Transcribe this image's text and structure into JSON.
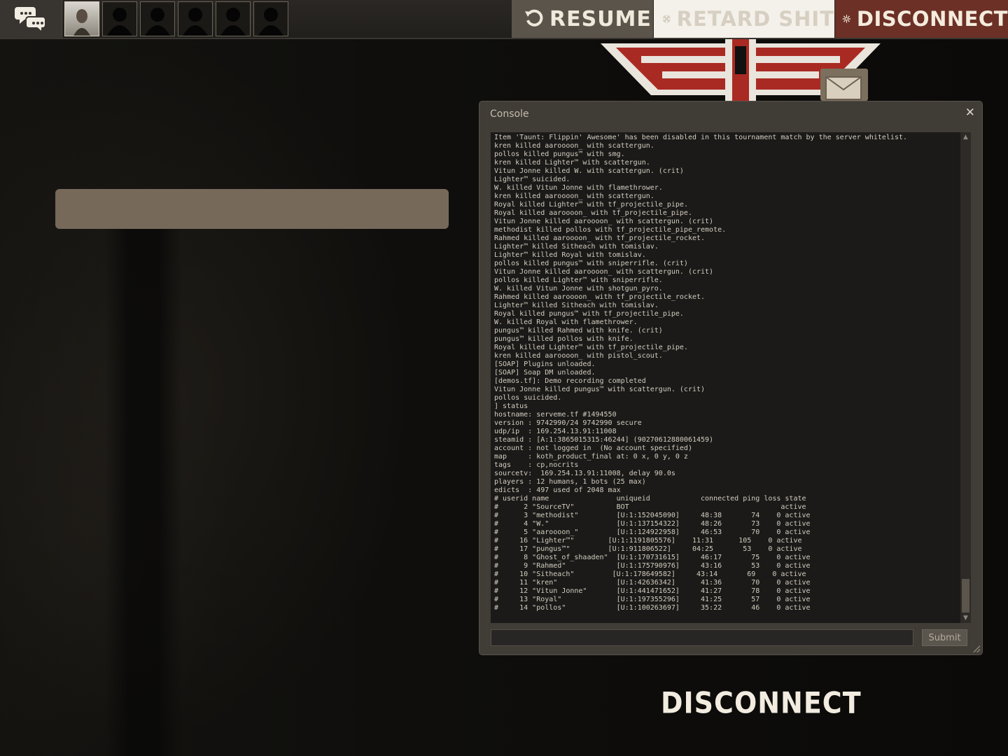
{
  "topbar": {
    "resume_label": "RESUME",
    "retard_label": "RETARD SHIT",
    "disconnect_label": "DISCONNECT"
  },
  "console": {
    "title": "Console",
    "close_glyph": "✕",
    "submit_label": "Submit",
    "input_value": "",
    "lines": [
      "Item 'Taunt: Flippin' Awesome' has been disabled in this tournament match by the server whitelist.",
      "kren killed aaroooon_ with scattergun.",
      "pollos killed pungus™ with smg.",
      "kren killed Lighter™ with scattergun.",
      "Vitun Jonne killed W. with scattergun. (crit)",
      "Lighter™ suicided.",
      "W. killed Vitun Jonne with flamethrower.",
      "kren killed aaroooon_ with scattergun.",
      "Royal killed Lighter™ with tf_projectile_pipe.",
      "Royal killed aaroooon_ with tf_projectile_pipe.",
      "Vitun Jonne killed aaroooon_ with scattergun. (crit)",
      "methodist killed pollos with tf_projectile_pipe_remote.",
      "Rahmed killed aaroooon_ with tf_projectile_rocket.",
      "Lighter™ killed Sitheach with tomislav.",
      "Lighter™ killed Royal with tomislav.",
      "pollos killed pungus™ with sniperrifle. (crit)",
      "Vitun Jonne killed aaroooon_ with scattergun. (crit)",
      "pollos killed Lighter™ with sniperrifle.",
      "W. killed Vitun Jonne with shotgun_pyro.",
      "Rahmed killed aaroooon_ with tf_projectile_rocket.",
      "Lighter™ killed Sitheach with tomislav.",
      "Royal killed pungus™ with tf_projectile_pipe.",
      "W. killed Royal with flamethrower.",
      "pungus™ killed Rahmed with knife. (crit)",
      "pungus™ killed pollos with knife.",
      "Royal killed Lighter™ with tf_projectile_pipe.",
      "kren killed aaroooon_ with pistol_scout.",
      "[SOAP] Plugins unloaded.",
      "[SOAP] Soap DM unloaded.",
      "[demos.tf]: Demo recording completed",
      "Vitun Jonne killed pungus™ with scattergun. (crit)",
      "pollos suicided.",
      "] status",
      "hostname: serveme.tf #1494550",
      "version : 9742990/24 9742990 secure",
      "udp/ip  : 169.254.13.91:11008",
      "steamid : [A:1:3865015315:46244] (90270612880061459)",
      "account : not logged in  (No account specified)",
      "map     : koth_product_final at: 0 x, 0 y, 0 z",
      "tags    : cp,nocrits",
      "sourcetv:  169.254.13.91:11008, delay 90.0s",
      "players : 12 humans, 1 bots (25 max)",
      "edicts  : 497 used of 2048 max",
      "# userid name                uniqueid            connected ping loss state",
      "#      2 \"SourceTV\"          BOT                                    active",
      "#      3 \"methodist\"         [U:1:152045090]     48:38       74    0 active",
      "#      4 \"W.\"                [U:1:137154322]     48:26       73    0 active",
      "#      5 \"aaroooon_\"         [U:1:124922958]     46:53       70    0 active",
      "#     16 \"Lighter™\"        [U:1:1191805576]    11:31      105    0 active",
      "#     17 \"pungus™\"         [U:1:911806522]     04:25       53    0 active",
      "#      8 \"Ghost_of_shaaden\"  [U:1:170731615]     46:17       75    0 active",
      "#      9 \"Rahmed\"            [U:1:175790976]     43:16       53    0 active",
      "#     10 \"Sitheach\"         [U:1:178649582]     43:14       69    0 active",
      "#     11 \"kren\"              [U:1:42636342]      41:36       70    0 active",
      "#     12 \"Vitun Jonne\"       [U:1:441471652]     41:27       78    0 active",
      "#     13 \"Royal\"             [U:1:197355296]     41:25       57    0 active",
      "#     14 \"pollos\"            [U:1:100263697]     35:22       46    0 active"
    ]
  },
  "disconnect_banner": "DISCONNECT",
  "colors": {
    "resume_bg": "#5a544b",
    "retard_bg": "#f4f1ea",
    "disconnect_bg": "#6c3026",
    "console_bg": "#403c36",
    "log_bg": "#1b1a19",
    "log_text": "#d4cdbf"
  },
  "icons": {
    "chat": "chat-bubbles-icon",
    "resume": "resume-arrow-icon",
    "retard": "tf2-logo-icon",
    "disconnect": "burst-icon"
  }
}
